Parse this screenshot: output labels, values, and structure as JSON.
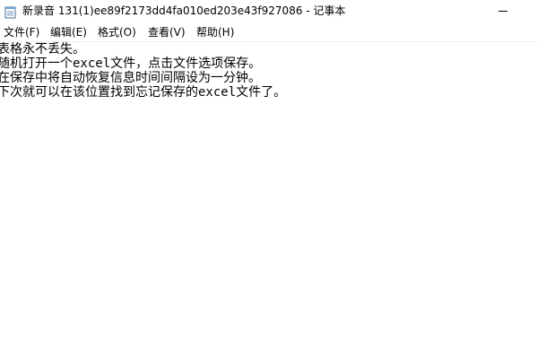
{
  "window": {
    "title": "新录音 131(1)ee89f2173dd4fa010ed203e43f927086 - 记事本",
    "app_icon": "notepad-icon"
  },
  "menu": {
    "items": [
      {
        "label": "文件(F)"
      },
      {
        "label": "编辑(E)"
      },
      {
        "label": "格式(O)"
      },
      {
        "label": "查看(V)"
      },
      {
        "label": "帮助(H)"
      }
    ]
  },
  "editor": {
    "lines": [
      "表格永不丢失。",
      "随机打开一个excel文件，点击文件选项保存。",
      "在保存中将自动恢复信息时间间隔设为一分钟。",
      "下次就可以在该位置找到忘记保存的excel文件了。"
    ]
  }
}
